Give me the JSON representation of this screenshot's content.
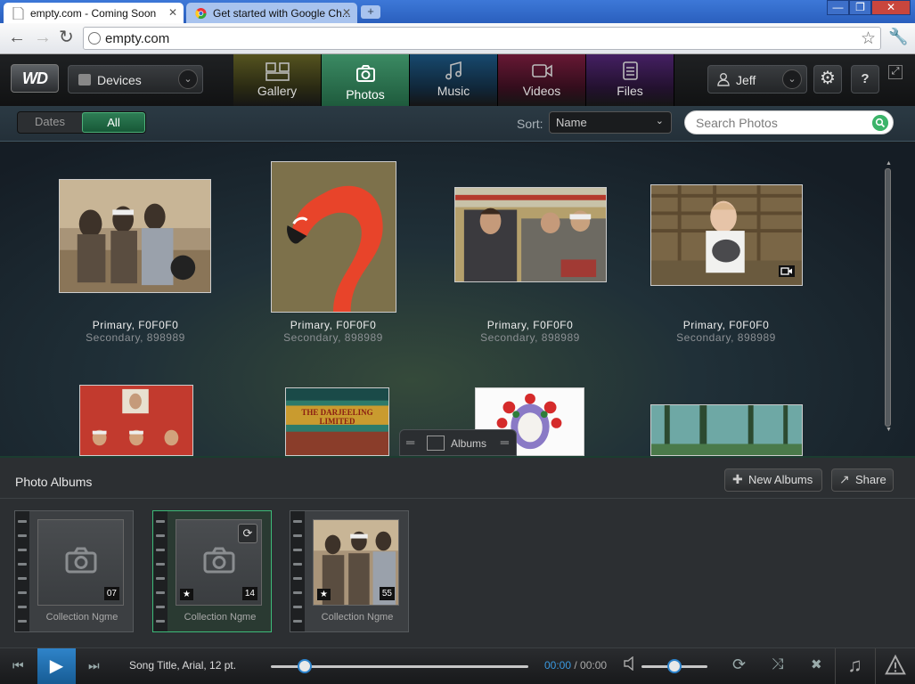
{
  "browser": {
    "tabs": [
      {
        "title": "empty.com - Coming Soon"
      },
      {
        "title": "Get started with Google Ch..."
      }
    ],
    "new_tab_symbol": "+",
    "url": "empty.com",
    "window_buttons": {
      "minimize": "—",
      "restore": "❐",
      "close": "✕"
    }
  },
  "app": {
    "logo": "WD",
    "device_label": "Devices",
    "nav": [
      {
        "label": "Gallery",
        "icon": "gallery-icon"
      },
      {
        "label": "Photos",
        "icon": "camera-icon",
        "active": true
      },
      {
        "label": "Music",
        "icon": "music-note-icon"
      },
      {
        "label": "Videos",
        "icon": "video-camera-icon"
      },
      {
        "label": "Files",
        "icon": "file-icon"
      }
    ],
    "user_name": "Jeff",
    "help_label": "?",
    "colors": {
      "accent_green": "#3cb46a",
      "play_blue": "#2d83cc"
    }
  },
  "filter": {
    "segments": [
      {
        "label": "Dates"
      },
      {
        "label": "All",
        "selected": true
      }
    ],
    "sort_label": "Sort:",
    "sort_value": "Name",
    "search_placeholder": "Search Photos"
  },
  "photos": [
    {
      "primary": "Primary, F0F0F0",
      "secondary": "Secondary, 898989",
      "scene": "three-on-motorcycle"
    },
    {
      "primary": "Primary, F0F0F0",
      "secondary": "Secondary, 898989",
      "scene": "flamingo"
    },
    {
      "primary": "Primary, F0F0F0",
      "secondary": "Secondary, 898989",
      "scene": "men-on-train"
    },
    {
      "primary": "Primary, F0F0F0",
      "secondary": "Secondary, 898989",
      "scene": "baby-with-kitten",
      "is_video": true
    },
    {
      "scene": "red-poster"
    },
    {
      "scene": "darjeeling-limited-poster",
      "poster_title": "THE DARJEELING LIMITED"
    },
    {
      "scene": "floral-skull-art"
    },
    {
      "scene": "forest"
    }
  ],
  "albums_handle": {
    "label": "Albums"
  },
  "albums_panel": {
    "title": "Photo Albums",
    "new_albums_label": "New Albums",
    "share_label": "Share",
    "cards": [
      {
        "name": "Collection Ngme",
        "count": "07",
        "starred": false,
        "selected": false,
        "thumb": "camera-placeholder"
      },
      {
        "name": "Collection Ngme",
        "count": "14",
        "starred": true,
        "selected": true,
        "thumb": "camera-placeholder",
        "sync": true
      },
      {
        "name": "Collection Ngme",
        "count": "55",
        "starred": true,
        "selected": false,
        "thumb": "three-men-photo"
      }
    ]
  },
  "player": {
    "song_title": "Song Title, Arial, 12 pt.",
    "time_current": "00:00",
    "time_sep": " / ",
    "time_total": "00:00",
    "progress": 0.13,
    "volume": 0.5
  }
}
